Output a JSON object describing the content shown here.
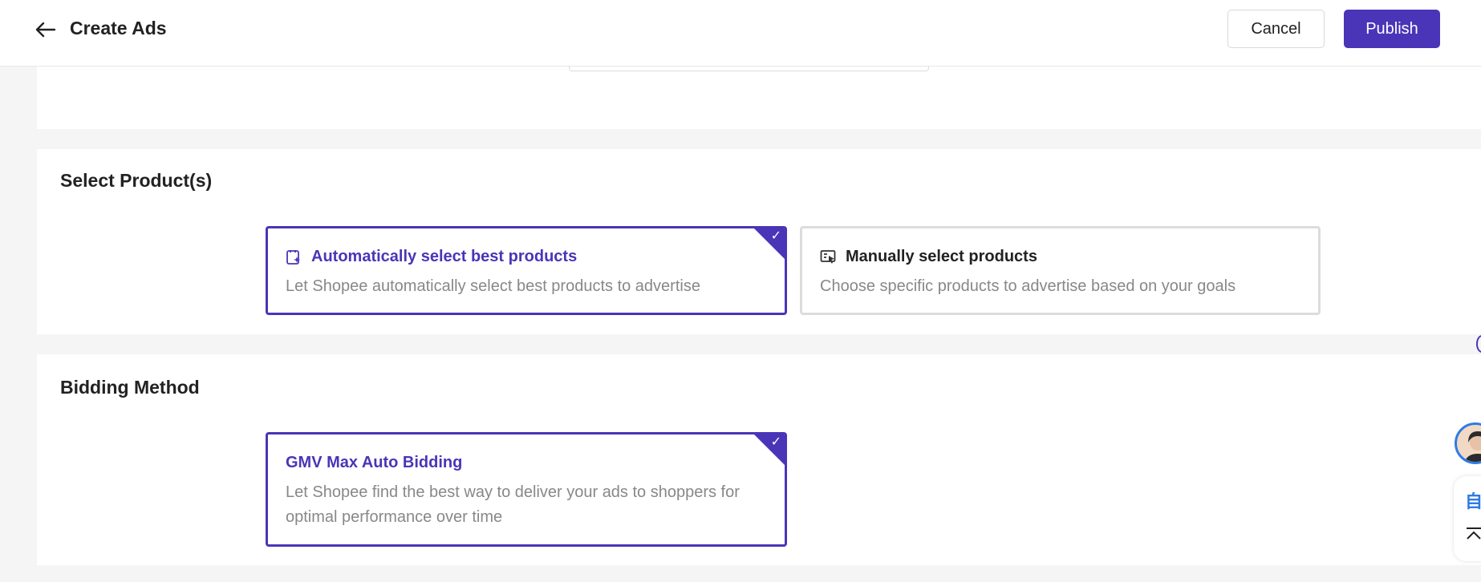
{
  "header": {
    "title": "Create Ads",
    "cancel_label": "Cancel",
    "publish_label": "Publish"
  },
  "select_products": {
    "title": "Select Product(s)",
    "options": [
      {
        "title": "Automatically select best products",
        "description": "Let Shopee automatically select best products to advertise",
        "selected": true,
        "icon": "auto-select-icon"
      },
      {
        "title": "Manually select products",
        "description": "Choose specific products to advertise based on your goals",
        "selected": false,
        "icon": "manual-select-icon"
      }
    ]
  },
  "bidding_method": {
    "title": "Bidding Method",
    "options": [
      {
        "title": "GMV Max Auto Bidding",
        "description_line1": "Let Shopee find the best way to deliver your ads to shoppers for",
        "description_line2": "optimal performance over time",
        "selected": true
      }
    ]
  },
  "side_widget": {
    "glyph": "自"
  },
  "colors": {
    "accent": "#4a35b8",
    "border": "#dcdcdc",
    "muted_text": "#888888",
    "page_bg": "#f5f5f5"
  }
}
